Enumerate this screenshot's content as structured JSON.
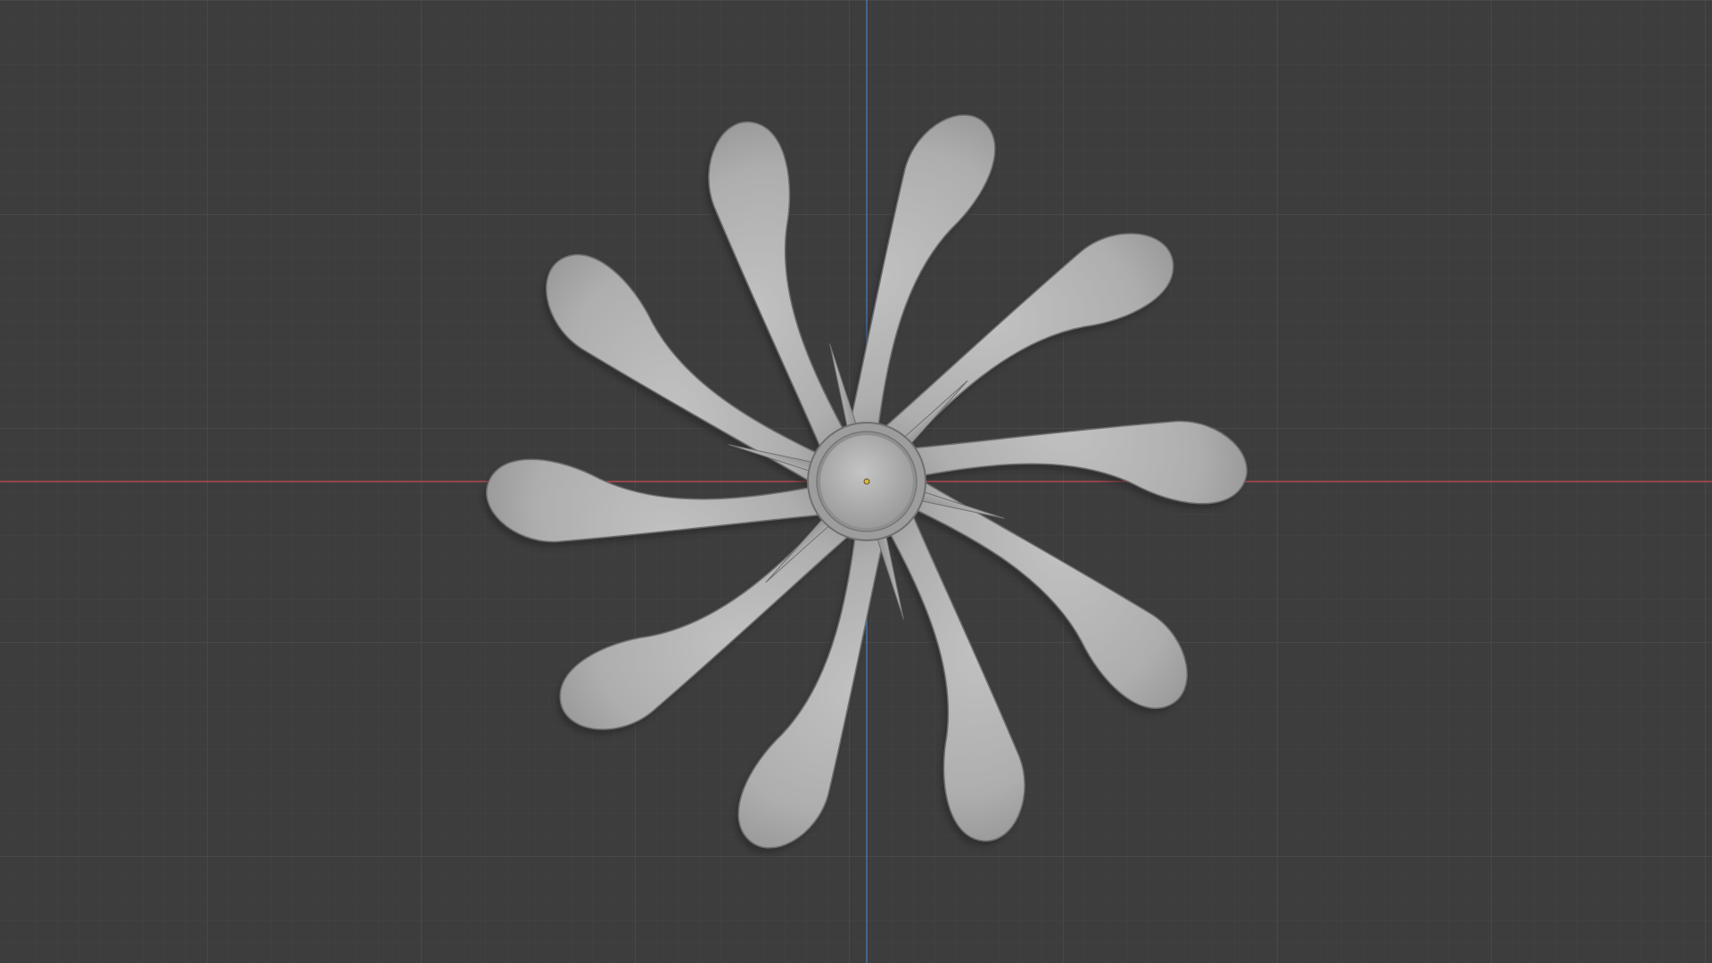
{
  "app": {
    "view": "top-orthographic",
    "background_color": "#3d3d3d",
    "grid_minor_color": "#444444",
    "grid_major_color": "#4c4c4c",
    "x_axis_color": "#c94b54",
    "y_axis_color": "#4a7fc1",
    "origin_color": "#e0b341"
  },
  "object": {
    "name_icon": "fan-propeller-mesh",
    "color": "#b4b4b4",
    "blade_count": 10,
    "spike_count": 6
  }
}
